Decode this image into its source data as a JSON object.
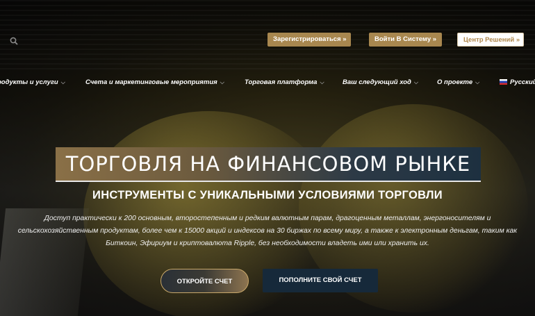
{
  "header": {
    "search_icon": "search-icon",
    "register_label": "Зарегистрироваться »",
    "login_label": "Войти В Систему »",
    "solutions_label": "Центр Решений »"
  },
  "nav": {
    "items": [
      {
        "label": "родукты и услуги",
        "chevron": "⌵"
      },
      {
        "label": "Счета и маркетинговые мероприятия",
        "chevron": "⌵"
      },
      {
        "label": "Торговая платформа",
        "chevron": "⌵"
      },
      {
        "label": "Ваш следующий ход",
        "chevron": "⌵"
      },
      {
        "label": "О проекте",
        "chevron": "⌵"
      },
      {
        "label": "Русский",
        "chevron": ""
      }
    ]
  },
  "hero": {
    "title": "ТОРГОВЛЯ НА ФИНАНСОВОМ РЫНКЕ",
    "subtitle": "ИНСТРУМЕНТЫ С УНИКАЛЬНЫМИ УСЛОВИЯМИ ТОРГОВЛИ",
    "description": "Доступ практически к 200 основным, второстепенным и редким валютным парам, драгоценным металлам, энергоносителям и сельскохозяйственным продуктам, более чем к 15000 акций и индексов на 30 биржах по всему миру, а также к электронным деньгам, таким как Биткоин, Эфириум и криптовалюта Ripple, без необходимости владеть ими или хранить их.",
    "open_account_label": "ОТКРОЙТЕ СЧЕТ",
    "deposit_label": "ПОПОЛНИТЕ СВОЙ СЧЕТ"
  },
  "colors": {
    "accent_gold": "#a8874f",
    "deposit_navy": "#16293a"
  }
}
